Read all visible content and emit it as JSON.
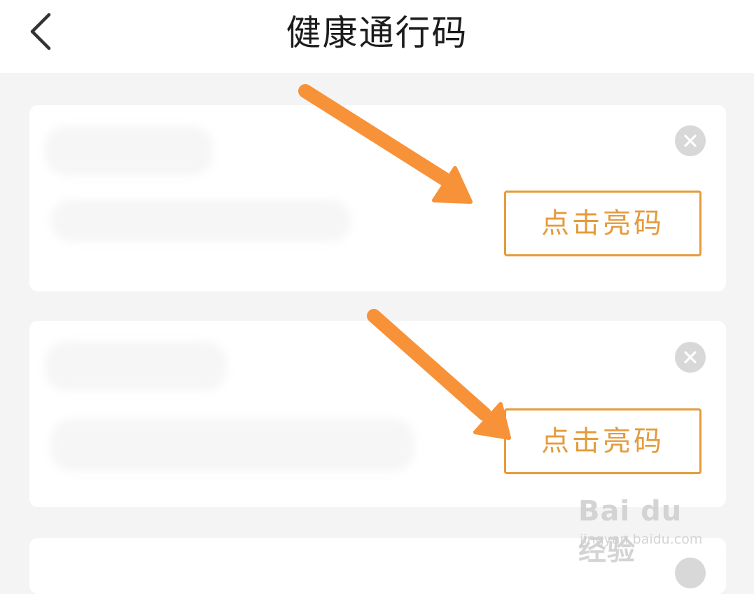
{
  "header": {
    "title": "健康通行码",
    "back_icon": "chevron-left-icon"
  },
  "cards": [
    {
      "button_label": "点击亮码",
      "close_icon": "close-circle-icon"
    },
    {
      "button_label": "点击亮码",
      "close_icon": "close-circle-icon"
    }
  ],
  "annotations": {
    "arrow_color": "#f89239"
  },
  "watermark": {
    "logo": "Bai du 经验",
    "url": "jingyan.baidu.com"
  },
  "colors": {
    "accent": "#e59b3b",
    "background": "#f4f4f4",
    "card": "#ffffff",
    "close_icon_bg": "#d8d8d8"
  }
}
